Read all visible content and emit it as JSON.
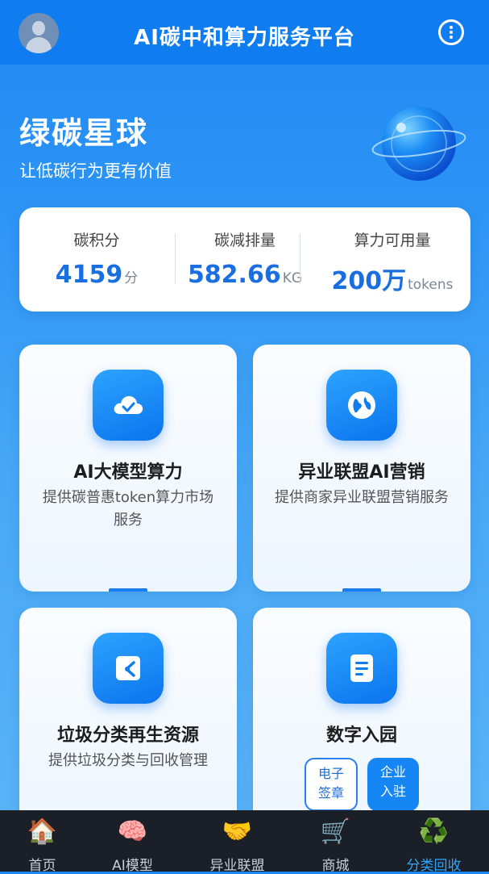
{
  "header": {
    "title": "AI碳中和算力服务平台",
    "avatar_icon": "user-avatar-icon",
    "menu_icon": "more-vertical-icon"
  },
  "hero": {
    "title": "绿碳星球",
    "subtitle": "让低碳行为更有价值",
    "image": "planet-globe"
  },
  "stats": [
    {
      "label": "碳积分",
      "value": "4159",
      "unit": "分"
    },
    {
      "label": "碳减排量",
      "value": "582.66",
      "unit": "KG"
    },
    {
      "label": "算力可用量",
      "value": "200万",
      "unit": "tokens"
    }
  ],
  "cards": [
    {
      "title": "AI大模型算力",
      "desc": "提供碳普惠token算力市场服务",
      "icon": "cloud-check-icon"
    },
    {
      "title": "异业联盟AI营销",
      "desc": "提供商家异业联盟营销服务",
      "icon": "globe-icon"
    },
    {
      "title": "垃圾分类再生资源",
      "desc": "提供垃圾分类与回收管理",
      "icon": "recycle-bin-icon"
    },
    {
      "title": "数字入园",
      "desc": "",
      "icon": "document-icon",
      "actions": [
        {
          "label": "电子签章"
        },
        {
          "label": "企业入驻"
        }
      ]
    }
  ],
  "tabbar": [
    {
      "label": "首页",
      "icon": "🏠",
      "active": false
    },
    {
      "label": "AI模型",
      "icon": "🧠",
      "active": false
    },
    {
      "label": "异业联盟",
      "icon": "🤝",
      "active": false
    },
    {
      "label": "商城",
      "icon": "🛒",
      "active": false
    },
    {
      "label": "分类回收",
      "icon": "♻️",
      "active": true
    }
  ],
  "colors": {
    "primary": "#0f7cf0",
    "value_blue": "#1a6fe0",
    "tab_active": "#2aa7ff",
    "tabbar_bg": "#1b1f27"
  }
}
